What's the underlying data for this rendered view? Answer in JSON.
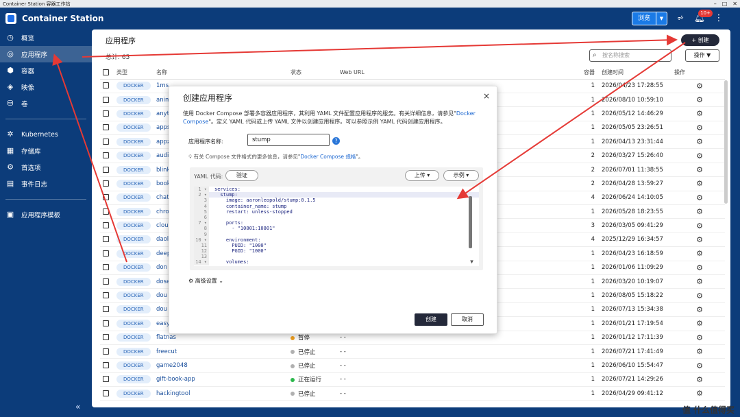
{
  "window": {
    "title": "Container Station 容器工作站",
    "controls": [
      "–",
      "□",
      "✕"
    ]
  },
  "header": {
    "app_title": "Container Station",
    "browse_label": "浏览",
    "notification_count": "10+"
  },
  "sidebar": {
    "items": [
      {
        "label": "概览",
        "icon": "overview-icon",
        "glyph": "◷"
      },
      {
        "label": "应用程序",
        "icon": "apps-icon",
        "glyph": "◎",
        "active": true
      },
      {
        "label": "容器",
        "icon": "container-icon",
        "glyph": "⬢"
      },
      {
        "label": "映像",
        "icon": "image-icon",
        "glyph": "◈"
      },
      {
        "label": "卷",
        "icon": "volume-icon",
        "glyph": "⛁"
      }
    ],
    "items2": [
      {
        "label": "Kubernetes",
        "icon": "kubernetes-icon",
        "glyph": "✲"
      },
      {
        "label": "存储库",
        "icon": "repository-icon",
        "glyph": "▦"
      },
      {
        "label": "首选项",
        "icon": "preferences-icon",
        "glyph": "⚙"
      },
      {
        "label": "事件日志",
        "icon": "event-log-icon",
        "glyph": "▤"
      }
    ],
    "items3": [
      {
        "label": "应用程序模板",
        "icon": "template-icon",
        "glyph": "▣"
      }
    ],
    "collapse_glyph": "«"
  },
  "main": {
    "title": "应用程序",
    "total": "总计: 65",
    "create_label": "+ 创建",
    "search_placeholder": "按名称搜索",
    "ops_label": "操作 ▼",
    "columns": [
      "类型",
      "名称",
      "状态",
      "Web URL",
      "容器",
      "创建时间",
      "操作"
    ],
    "rows": [
      {
        "type": "DOCKER",
        "name": "1ms",
        "status": "",
        "status_color": "",
        "url": "",
        "containers": "1",
        "created": "2026/04/23 17:28:55"
      },
      {
        "type": "DOCKER",
        "name": "anim",
        "status": "",
        "status_color": "",
        "url": "",
        "containers": "1",
        "created": "2026/08/10 10:59:10"
      },
      {
        "type": "DOCKER",
        "name": "anyt",
        "status": "",
        "status_color": "",
        "url": "",
        "containers": "1",
        "created": "2026/05/12 14:46:29"
      },
      {
        "type": "DOCKER",
        "name": "apps",
        "status": "",
        "status_color": "",
        "url": "",
        "containers": "1",
        "created": "2026/05/05 23:26:51"
      },
      {
        "type": "DOCKER",
        "name": "appz",
        "status": "",
        "status_color": "",
        "url": "",
        "containers": "1",
        "created": "2026/04/13 23:31:44"
      },
      {
        "type": "DOCKER",
        "name": "audi",
        "status": "",
        "status_color": "",
        "url": "",
        "containers": "2",
        "created": "2026/03/27 15:26:40"
      },
      {
        "type": "DOCKER",
        "name": "blink",
        "status": "",
        "status_color": "",
        "url": "",
        "containers": "2",
        "created": "2026/07/01 11:38:55"
      },
      {
        "type": "DOCKER",
        "name": "book",
        "status": "",
        "status_color": "",
        "url": "",
        "containers": "2",
        "created": "2026/04/28 13:59:27"
      },
      {
        "type": "DOCKER",
        "name": "chat",
        "status": "",
        "status_color": "",
        "url": "",
        "containers": "4",
        "created": "2026/06/24 14:10:05"
      },
      {
        "type": "DOCKER",
        "name": "chro",
        "status": "",
        "status_color": "",
        "url": "",
        "containers": "1",
        "created": "2026/05/28 18:23:55"
      },
      {
        "type": "DOCKER",
        "name": "clou",
        "status": "",
        "status_color": "",
        "url": "",
        "containers": "3",
        "created": "2026/03/05 09:41:29"
      },
      {
        "type": "DOCKER",
        "name": "daol",
        "status": "",
        "status_color": "",
        "url": "",
        "containers": "4",
        "created": "2025/12/29 16:34:57"
      },
      {
        "type": "DOCKER",
        "name": "deep",
        "status": "",
        "status_color": "",
        "url": "",
        "containers": "1",
        "created": "2026/04/23 16:18:59"
      },
      {
        "type": "DOCKER",
        "name": "don",
        "status": "",
        "status_color": "",
        "url": "",
        "containers": "1",
        "created": "2026/01/06 11:09:29"
      },
      {
        "type": "DOCKER",
        "name": "dose",
        "status": "",
        "status_color": "",
        "url": "",
        "containers": "1",
        "created": "2026/03/20 10:19:07"
      },
      {
        "type": "DOCKER",
        "name": "dou",
        "status": "",
        "status_color": "",
        "url": "",
        "containers": "1",
        "created": "2026/08/05 15:18:22"
      },
      {
        "type": "DOCKER",
        "name": "dou",
        "status": "",
        "status_color": "",
        "url": "",
        "containers": "1",
        "created": "2026/07/13 15:34:38"
      },
      {
        "type": "DOCKER",
        "name": "easy",
        "status": "",
        "status_color": "",
        "url": "",
        "containers": "1",
        "created": "2026/01/21 17:19:54"
      },
      {
        "type": "DOCKER",
        "name": "flatnas",
        "status": "暂停",
        "status_color": "#f0a020",
        "url": "- -",
        "containers": "1",
        "created": "2026/01/12 17:11:39"
      },
      {
        "type": "DOCKER",
        "name": "freecut",
        "status": "已停止",
        "status_color": "#b0b0b0",
        "url": "- -",
        "containers": "1",
        "created": "2026/07/21 17:41:49"
      },
      {
        "type": "DOCKER",
        "name": "game2048",
        "status": "已停止",
        "status_color": "#b0b0b0",
        "url": "- -",
        "containers": "1",
        "created": "2026/06/10 15:54:47"
      },
      {
        "type": "DOCKER",
        "name": "gift-book-app",
        "status": "正在运行",
        "status_color": "#2db84d",
        "url": "- -",
        "containers": "1",
        "created": "2026/07/21 14:29:26"
      },
      {
        "type": "DOCKER",
        "name": "hackingtool",
        "status": "已停止",
        "status_color": "#b0b0b0",
        "url": "- -",
        "containers": "1",
        "created": "2026/04/29 09:41:12"
      }
    ]
  },
  "dialog": {
    "title": "创建应用程序",
    "close": "×",
    "desc_part1": "使用 Docker Compose 部署多容器应用程序，其利用 YAML 文件配置应用程序的服务。有关详细信息，请参见\"",
    "desc_link": "Docker Compose",
    "desc_part2": "\"。定义 YAML 代码或上传 YAML 文件以创建应用程序。可以参照示例 YAML 代码创建应用程序。",
    "app_name_label": "应用程序名称:",
    "app_name_value": "stump",
    "hint_part1": "有关 Compose 文件格式的更多信息，请参见\"",
    "hint_link": "Docker Compose 规格",
    "hint_part2": "\"。",
    "yaml_label": "YAML 代码:",
    "verify_label": "验证",
    "upload_label": "上传 ▾",
    "example_label": "示例 ▾",
    "code_lines": [
      {
        "n": "1 ▾",
        "text": "services:",
        "hl": false
      },
      {
        "n": "2 ▾",
        "text": "  stump:",
        "hl": true
      },
      {
        "n": "3",
        "text": "    image: aaronleopold/stump:0.1.5",
        "hl": false
      },
      {
        "n": "4",
        "text": "    container_name: stump",
        "hl": false
      },
      {
        "n": "5",
        "text": "    restart: unless-stopped",
        "hl": false
      },
      {
        "n": "6",
        "text": "",
        "hl": false
      },
      {
        "n": "7 ▾",
        "text": "    ports:",
        "hl": false
      },
      {
        "n": "8",
        "text": "      - \"10801:10801\"",
        "hl": false
      },
      {
        "n": "9",
        "text": "",
        "hl": false
      },
      {
        "n": "10 ▾",
        "text": "    environment:",
        "hl": false
      },
      {
        "n": "11",
        "text": "      PUID: \"1000\"",
        "hl": false
      },
      {
        "n": "12",
        "text": "      PGID: \"1000\"",
        "hl": false
      },
      {
        "n": "13",
        "text": "",
        "hl": false
      },
      {
        "n": "14 ▾",
        "text": "    volumes:",
        "hl": false
      }
    ],
    "advanced_label": "高级设置",
    "create_label": "创建",
    "cancel_label": "取消"
  },
  "watermark": "值 什么值得买",
  "colors": {
    "sidebar_bg": "#0c3c7a",
    "accent": "#1a7ae6",
    "arrow": "#e53935",
    "dark_button": "#24293a"
  }
}
